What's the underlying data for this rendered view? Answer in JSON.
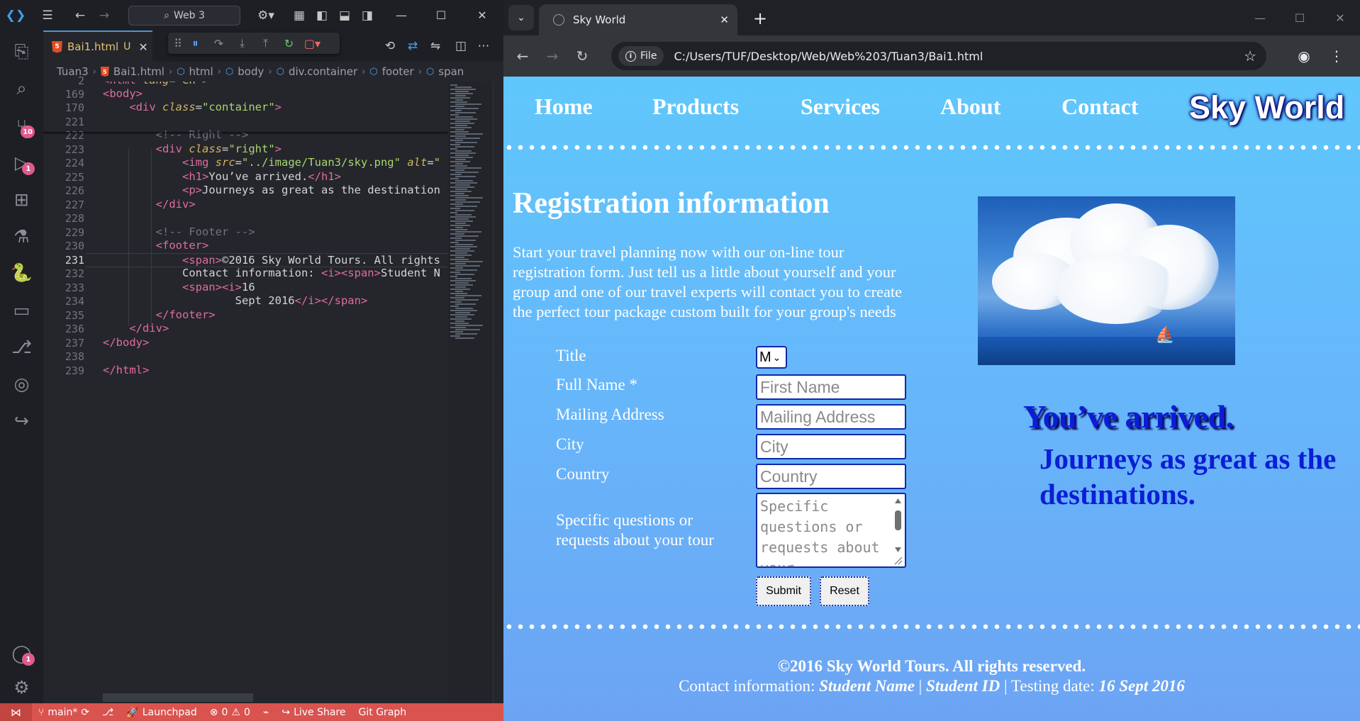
{
  "vscode": {
    "search_text": "Web 3",
    "tab": {
      "filename": "Bai1.html",
      "status": "U",
      "icon_label": "5"
    },
    "breadcrumb": [
      "Tuan3",
      "Bai1.html",
      "html",
      "body",
      "div.container",
      "footer",
      "span"
    ],
    "badges": {
      "source_control": "10",
      "run_debug": "1",
      "accounts": "1"
    },
    "lines": [
      {
        "num": "2",
        "html": "<span class=\"t\">&lt;html</span> <span class=\"a\">lang</span><span class=\"p\">=</span><span class=\"s\">\"en\"</span><span class=\"t\">&gt;</span>"
      },
      {
        "num": "169",
        "html": "<span class=\"t\">&lt;body&gt;</span>"
      },
      {
        "num": "170",
        "html": "    <span class=\"t\">&lt;div</span> <span class=\"a\">class</span><span class=\"p\">=</span><span class=\"s\">\"container\"</span><span class=\"t\">&gt;</span>"
      },
      {
        "num": "221",
        "html": ""
      },
      {
        "num": "222",
        "html": "        <span class=\"c\">&lt;!-- Right --&gt;</span>"
      },
      {
        "num": "223",
        "html": "        <span class=\"t\">&lt;div</span> <span class=\"a\">class</span><span class=\"p\">=</span><span class=\"s\">\"right\"</span><span class=\"t\">&gt;</span>"
      },
      {
        "num": "224",
        "html": "            <span class=\"t\">&lt;img</span> <span class=\"a\">src</span><span class=\"p\">=</span><span class=\"s\">\"<span class=\"ul\">../image/Tuan3/sky.png</span>\"</span> <span class=\"a\">alt</span><span class=\"p\">=</span><span class=\"s\">\"</span>"
      },
      {
        "num": "225",
        "html": "            <span class=\"t\">&lt;h1&gt;</span>You’ve arrived.<span class=\"t\">&lt;/h1&gt;</span>"
      },
      {
        "num": "226",
        "html": "            <span class=\"t\">&lt;p&gt;</span>Journeys as great as the destination"
      },
      {
        "num": "227",
        "html": "        <span class=\"t\">&lt;/div&gt;</span>"
      },
      {
        "num": "228",
        "html": ""
      },
      {
        "num": "229",
        "html": "        <span class=\"c\">&lt;!-- Footer --&gt;</span>"
      },
      {
        "num": "230",
        "html": "        <span class=\"t\">&lt;footer&gt;</span>"
      },
      {
        "num": "231",
        "html": "            <span class=\"t\">&lt;span&gt;</span>©2016 Sky World Tours. All rights"
      },
      {
        "num": "232",
        "html": "            Contact information: <span class=\"t\">&lt;i&gt;&lt;span&gt;</span>Student N"
      },
      {
        "num": "233",
        "html": "            <span class=\"t\">&lt;span&gt;&lt;i&gt;</span>16"
      },
      {
        "num": "234",
        "html": "                    Sept 2016<span class=\"t\">&lt;/i&gt;&lt;/span&gt;</span>"
      },
      {
        "num": "235",
        "html": "        <span class=\"t\">&lt;/footer&gt;</span>"
      },
      {
        "num": "236",
        "html": "    <span class=\"t\">&lt;/div&gt;</span>"
      },
      {
        "num": "237",
        "html": "<span class=\"t\">&lt;/body&gt;</span>"
      },
      {
        "num": "238",
        "html": ""
      },
      {
        "num": "239",
        "html": "<span class=\"t\">&lt;/html&gt;</span>"
      }
    ],
    "current_line": "231",
    "status": {
      "branch": "main*",
      "launchpad": "Launchpad",
      "errors": "0",
      "warnings": "0",
      "live_share": "Live Share",
      "git_graph": "Git Graph"
    }
  },
  "browser": {
    "tab_title": "Sky World",
    "chip_label": "File",
    "url": "C:/Users/TUF/Desktop/Web/Web%203/Tuan3/Bai1.html"
  },
  "site": {
    "nav": [
      "Home",
      "Products",
      "Services",
      "About",
      "Contact"
    ],
    "logo": "Sky World",
    "form_title": "Registration information",
    "intro": "Start your travel planning now with our on-line tour registration form. Just tell us a little about yourself and your group and one of our travel experts will contact you to create the perfect tour package custom built for your group's needs",
    "labels": {
      "title": "Title",
      "full_name": "Full Name *",
      "mailing": "Mailing Address",
      "city": "City",
      "country": "Country",
      "questions": "Specific questions or requests about your tour"
    },
    "select_value": "M",
    "placeholders": {
      "first_name": "First Name",
      "mailing": "Mailing Address",
      "city": "City",
      "country": "Country",
      "questions": "Specific questions or requests about your"
    },
    "buttons": {
      "submit": "Submit",
      "reset": "Reset"
    },
    "heading": "You’ve arrived.",
    "tagline": "Journeys as great as the destinations.",
    "footer": {
      "copyright": "©2016 Sky World Tours. All rights reserved.",
      "contact_prefix": "Contact information: ",
      "student_name": "Student Name",
      "sep": " | ",
      "student_id": "Student ID",
      "testing_prefix": " Testing date: ",
      "date": "16 Sept 2016"
    }
  }
}
